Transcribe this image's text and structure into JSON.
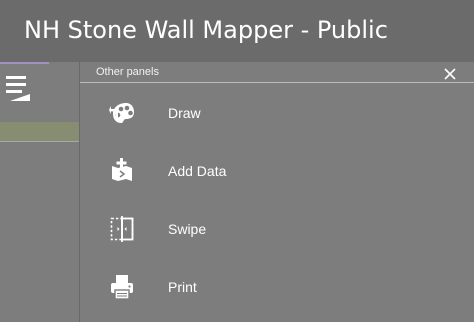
{
  "app": {
    "title": "NH Stone Wall Mapper - Public"
  },
  "panel": {
    "title": "Other panels",
    "close_icon": "close-icon",
    "items": [
      {
        "label": "Draw",
        "icon": "palette-icon"
      },
      {
        "label": "Add Data",
        "icon": "add-data-icon"
      },
      {
        "label": "Swipe",
        "icon": "swipe-icon"
      },
      {
        "label": "Print",
        "icon": "printer-icon"
      }
    ]
  },
  "left_strip": {
    "menu_icon": "hamburger-menu-icon"
  },
  "colors": {
    "header_bg": "#6b6b6b",
    "panel_bg": "#7d7d7d",
    "accent": "#a58fc2",
    "selected_row": "#878d71",
    "text": "#ffffff"
  }
}
